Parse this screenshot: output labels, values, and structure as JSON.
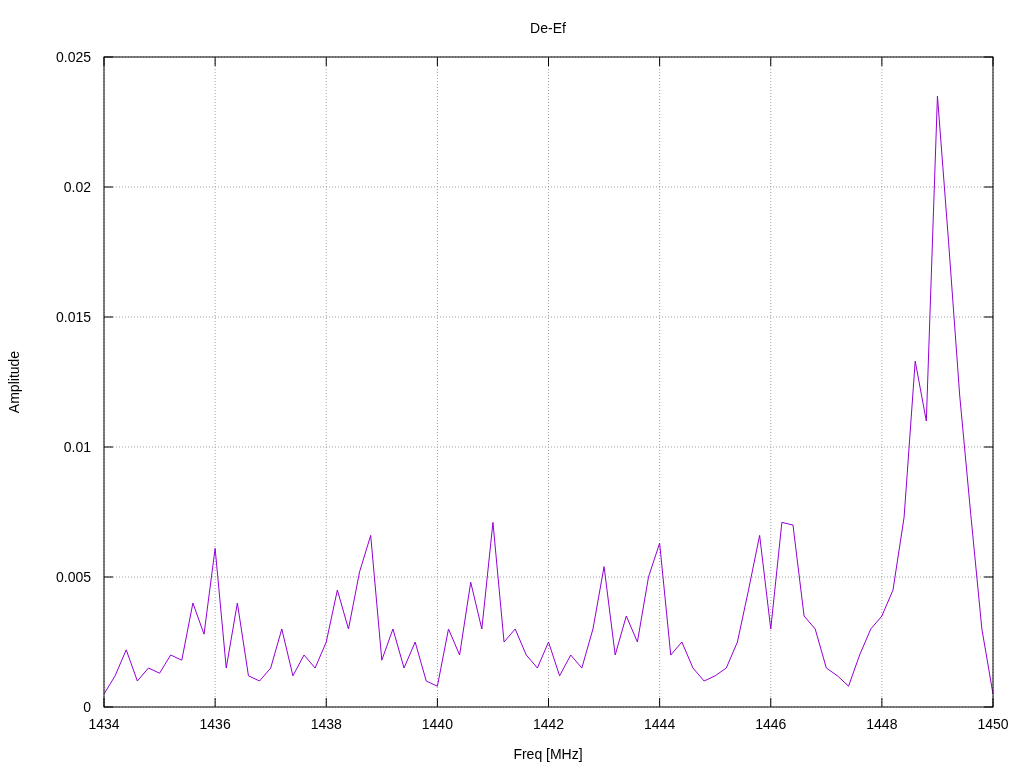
{
  "chart_data": {
    "type": "line",
    "title": "De-Ef",
    "xlabel": "Freq [MHz]",
    "ylabel": "Amplitude",
    "grid": true,
    "xlim": [
      1434,
      1450
    ],
    "ylim": [
      0,
      0.025
    ],
    "xticks": [
      1434,
      1436,
      1438,
      1440,
      1442,
      1444,
      1446,
      1448,
      1450
    ],
    "yticks": [
      {
        "value": 0,
        "label": "0"
      },
      {
        "value": 0.005,
        "label": "0.005"
      },
      {
        "value": 0.01,
        "label": "0.01"
      },
      {
        "value": 0.015,
        "label": "0.015"
      },
      {
        "value": 0.02,
        "label": "0.02"
      },
      {
        "value": 0.025,
        "label": "0.025"
      }
    ],
    "x": [
      1434.0,
      1434.2,
      1434.4,
      1434.6,
      1434.8,
      1435.0,
      1435.2,
      1435.4,
      1435.6,
      1435.8,
      1436.0,
      1436.2,
      1436.4,
      1436.6,
      1436.8,
      1437.0,
      1437.2,
      1437.4,
      1437.6,
      1437.8,
      1438.0,
      1438.2,
      1438.4,
      1438.6,
      1438.8,
      1439.0,
      1439.2,
      1439.4,
      1439.6,
      1439.8,
      1440.0,
      1440.2,
      1440.4,
      1440.6,
      1440.8,
      1441.0,
      1441.2,
      1441.4,
      1441.6,
      1441.8,
      1442.0,
      1442.2,
      1442.4,
      1442.6,
      1442.8,
      1443.0,
      1443.2,
      1443.4,
      1443.6,
      1443.8,
      1444.0,
      1444.2,
      1444.4,
      1444.6,
      1444.8,
      1445.0,
      1445.2,
      1445.4,
      1445.6,
      1445.8,
      1446.0,
      1446.2,
      1446.4,
      1446.6,
      1446.8,
      1447.0,
      1447.2,
      1447.4,
      1447.6,
      1447.8,
      1448.0,
      1448.2,
      1448.4,
      1448.6,
      1448.8,
      1449.0,
      1449.2,
      1449.4,
      1449.6,
      1449.8,
      1450.0
    ],
    "series": [
      {
        "color": "#9400d3",
        "values": [
          0.0005,
          0.0012,
          0.0022,
          0.001,
          0.0015,
          0.0013,
          0.002,
          0.0018,
          0.004,
          0.0028,
          0.0061,
          0.0015,
          0.004,
          0.0012,
          0.001,
          0.0015,
          0.003,
          0.0012,
          0.002,
          0.0015,
          0.0025,
          0.0045,
          0.003,
          0.0052,
          0.0066,
          0.0018,
          0.003,
          0.0015,
          0.0025,
          0.001,
          0.0008,
          0.003,
          0.002,
          0.0048,
          0.003,
          0.0071,
          0.0025,
          0.003,
          0.002,
          0.0015,
          0.0025,
          0.0012,
          0.002,
          0.0015,
          0.003,
          0.0054,
          0.002,
          0.0035,
          0.0025,
          0.005,
          0.0063,
          0.002,
          0.0025,
          0.0015,
          0.001,
          0.0012,
          0.0015,
          0.0025,
          0.0045,
          0.0066,
          0.003,
          0.0071,
          0.007,
          0.0035,
          0.003,
          0.0015,
          0.0012,
          0.0008,
          0.002,
          0.003,
          0.0035,
          0.0045,
          0.0073,
          0.0133,
          0.011,
          0.0235,
          0.0179,
          0.012,
          0.0074,
          0.003,
          0.0005
        ]
      }
    ]
  }
}
